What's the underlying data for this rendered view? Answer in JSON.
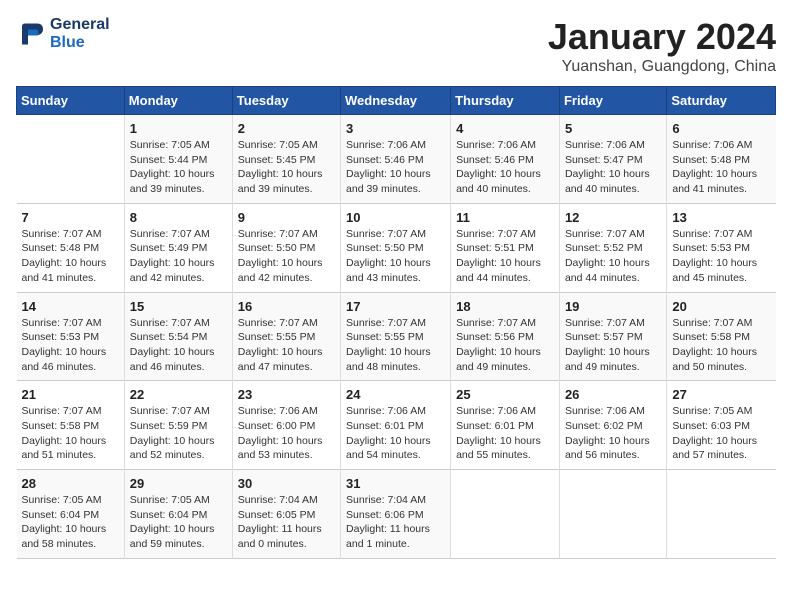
{
  "header": {
    "logo_line1": "General",
    "logo_line2": "Blue",
    "title": "January 2024",
    "subtitle": "Yuanshan, Guangdong, China"
  },
  "days_of_week": [
    "Sunday",
    "Monday",
    "Tuesday",
    "Wednesday",
    "Thursday",
    "Friday",
    "Saturday"
  ],
  "weeks": [
    [
      {
        "day": "",
        "info": ""
      },
      {
        "day": "1",
        "info": "Sunrise: 7:05 AM\nSunset: 5:44 PM\nDaylight: 10 hours\nand 39 minutes."
      },
      {
        "day": "2",
        "info": "Sunrise: 7:05 AM\nSunset: 5:45 PM\nDaylight: 10 hours\nand 39 minutes."
      },
      {
        "day": "3",
        "info": "Sunrise: 7:06 AM\nSunset: 5:46 PM\nDaylight: 10 hours\nand 39 minutes."
      },
      {
        "day": "4",
        "info": "Sunrise: 7:06 AM\nSunset: 5:46 PM\nDaylight: 10 hours\nand 40 minutes."
      },
      {
        "day": "5",
        "info": "Sunrise: 7:06 AM\nSunset: 5:47 PM\nDaylight: 10 hours\nand 40 minutes."
      },
      {
        "day": "6",
        "info": "Sunrise: 7:06 AM\nSunset: 5:48 PM\nDaylight: 10 hours\nand 41 minutes."
      }
    ],
    [
      {
        "day": "7",
        "info": "Sunrise: 7:07 AM\nSunset: 5:48 PM\nDaylight: 10 hours\nand 41 minutes."
      },
      {
        "day": "8",
        "info": "Sunrise: 7:07 AM\nSunset: 5:49 PM\nDaylight: 10 hours\nand 42 minutes."
      },
      {
        "day": "9",
        "info": "Sunrise: 7:07 AM\nSunset: 5:50 PM\nDaylight: 10 hours\nand 42 minutes."
      },
      {
        "day": "10",
        "info": "Sunrise: 7:07 AM\nSunset: 5:50 PM\nDaylight: 10 hours\nand 43 minutes."
      },
      {
        "day": "11",
        "info": "Sunrise: 7:07 AM\nSunset: 5:51 PM\nDaylight: 10 hours\nand 44 minutes."
      },
      {
        "day": "12",
        "info": "Sunrise: 7:07 AM\nSunset: 5:52 PM\nDaylight: 10 hours\nand 44 minutes."
      },
      {
        "day": "13",
        "info": "Sunrise: 7:07 AM\nSunset: 5:53 PM\nDaylight: 10 hours\nand 45 minutes."
      }
    ],
    [
      {
        "day": "14",
        "info": "Sunrise: 7:07 AM\nSunset: 5:53 PM\nDaylight: 10 hours\nand 46 minutes."
      },
      {
        "day": "15",
        "info": "Sunrise: 7:07 AM\nSunset: 5:54 PM\nDaylight: 10 hours\nand 46 minutes."
      },
      {
        "day": "16",
        "info": "Sunrise: 7:07 AM\nSunset: 5:55 PM\nDaylight: 10 hours\nand 47 minutes."
      },
      {
        "day": "17",
        "info": "Sunrise: 7:07 AM\nSunset: 5:55 PM\nDaylight: 10 hours\nand 48 minutes."
      },
      {
        "day": "18",
        "info": "Sunrise: 7:07 AM\nSunset: 5:56 PM\nDaylight: 10 hours\nand 49 minutes."
      },
      {
        "day": "19",
        "info": "Sunrise: 7:07 AM\nSunset: 5:57 PM\nDaylight: 10 hours\nand 49 minutes."
      },
      {
        "day": "20",
        "info": "Sunrise: 7:07 AM\nSunset: 5:58 PM\nDaylight: 10 hours\nand 50 minutes."
      }
    ],
    [
      {
        "day": "21",
        "info": "Sunrise: 7:07 AM\nSunset: 5:58 PM\nDaylight: 10 hours\nand 51 minutes."
      },
      {
        "day": "22",
        "info": "Sunrise: 7:07 AM\nSunset: 5:59 PM\nDaylight: 10 hours\nand 52 minutes."
      },
      {
        "day": "23",
        "info": "Sunrise: 7:06 AM\nSunset: 6:00 PM\nDaylight: 10 hours\nand 53 minutes."
      },
      {
        "day": "24",
        "info": "Sunrise: 7:06 AM\nSunset: 6:01 PM\nDaylight: 10 hours\nand 54 minutes."
      },
      {
        "day": "25",
        "info": "Sunrise: 7:06 AM\nSunset: 6:01 PM\nDaylight: 10 hours\nand 55 minutes."
      },
      {
        "day": "26",
        "info": "Sunrise: 7:06 AM\nSunset: 6:02 PM\nDaylight: 10 hours\nand 56 minutes."
      },
      {
        "day": "27",
        "info": "Sunrise: 7:05 AM\nSunset: 6:03 PM\nDaylight: 10 hours\nand 57 minutes."
      }
    ],
    [
      {
        "day": "28",
        "info": "Sunrise: 7:05 AM\nSunset: 6:04 PM\nDaylight: 10 hours\nand 58 minutes."
      },
      {
        "day": "29",
        "info": "Sunrise: 7:05 AM\nSunset: 6:04 PM\nDaylight: 10 hours\nand 59 minutes."
      },
      {
        "day": "30",
        "info": "Sunrise: 7:04 AM\nSunset: 6:05 PM\nDaylight: 11 hours\nand 0 minutes."
      },
      {
        "day": "31",
        "info": "Sunrise: 7:04 AM\nSunset: 6:06 PM\nDaylight: 11 hours\nand 1 minute."
      },
      {
        "day": "",
        "info": ""
      },
      {
        "day": "",
        "info": ""
      },
      {
        "day": "",
        "info": ""
      }
    ]
  ]
}
